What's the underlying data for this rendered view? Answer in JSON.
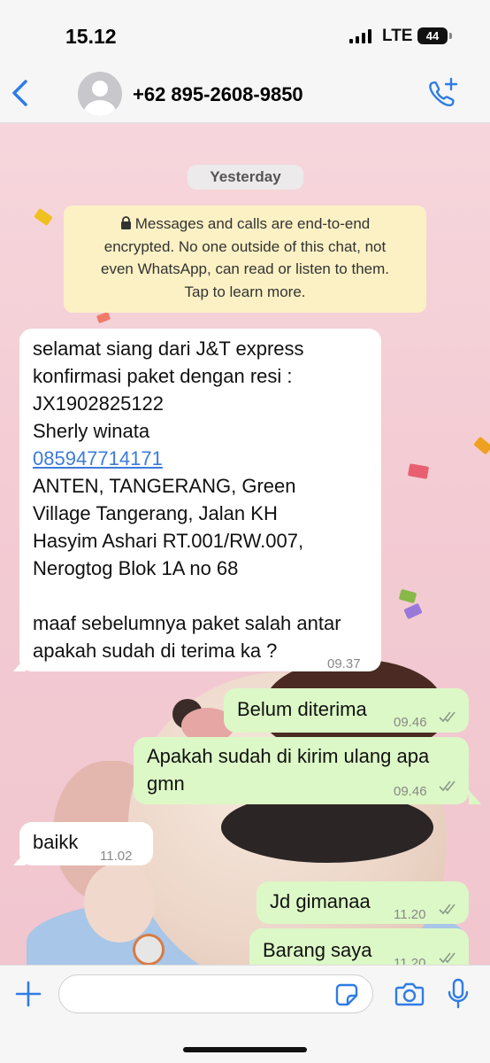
{
  "status_bar": {
    "time": "15.12",
    "network": "LTE",
    "battery": "44"
  },
  "header": {
    "contact_name": "+62 895-2608-9850",
    "back_icon": "chevron-left-icon",
    "call_icon": "phone-plus-icon",
    "accent_color": "#2f7ce6"
  },
  "chat": {
    "date_label": "Yesterday",
    "encryption_notice": {
      "line1": "Messages and calls are end-to-end",
      "line2": "encrypted. No one outside of this chat, not",
      "line3": "even WhatsApp, can read or listen to them.",
      "line4": "Tap to learn more."
    },
    "messages": [
      {
        "direction": "incoming",
        "lines": [
          "selamat siang dari J&T express",
          "konfirmasi paket dengan resi :",
          "JX1902825122",
          "Sherly winata",
          "085947714171",
          "ANTEN, TANGERANG, Green",
          "Village Tangerang, Jalan KH",
          "Hasyim Ashari RT.001/RW.007,",
          "Nerogtog Blok 1A no 68",
          "",
          "maaf sebelumnya paket salah antar",
          "apakah sudah di terima ka ?"
        ],
        "time": "09.37"
      },
      {
        "direction": "outgoing",
        "lines": [
          "Belum diterima"
        ],
        "time": "09.46"
      },
      {
        "direction": "outgoing",
        "lines": [
          "Apakah sudah di kirim ulang apa",
          "gmn"
        ],
        "time": "09.46"
      },
      {
        "direction": "incoming",
        "lines": [
          "baikk"
        ],
        "time": "11.02"
      },
      {
        "direction": "outgoing",
        "lines": [
          "Jd gimanaa"
        ],
        "time": "11.20"
      },
      {
        "direction": "outgoing",
        "lines": [
          "Barang saya"
        ],
        "time": "11.20"
      }
    ],
    "bubble_colors": {
      "incoming": "#ffffff",
      "outgoing": "#dcf8c6"
    }
  },
  "input_bar": {
    "message_value": "",
    "icons": [
      "plus-icon",
      "sticker-icon",
      "camera-icon",
      "microphone-icon"
    ]
  }
}
